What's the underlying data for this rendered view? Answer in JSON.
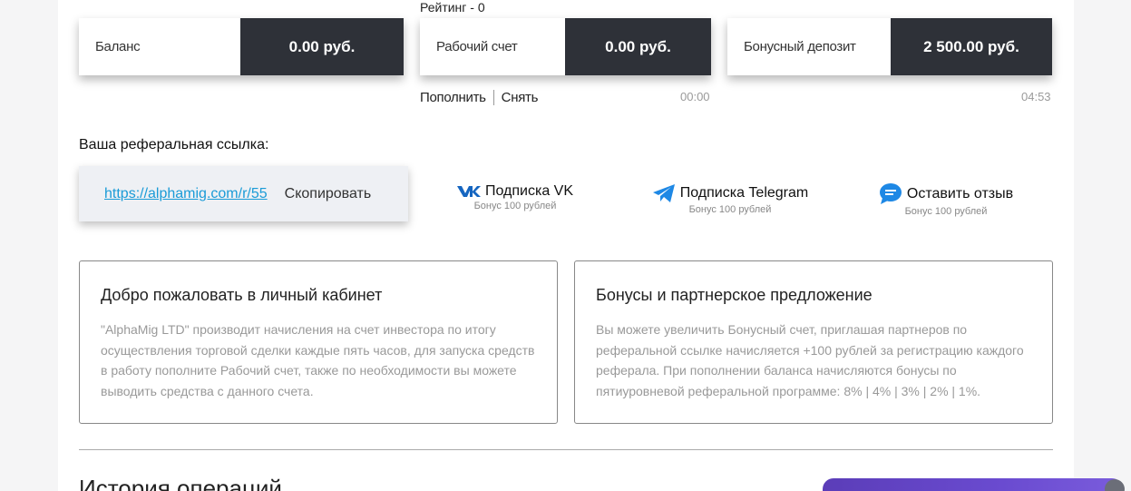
{
  "rating": "Рейтинг - 0",
  "cards": [
    {
      "label": "Баланс",
      "value": "0.00 руб."
    },
    {
      "label": "Рабочий счет",
      "value": "0.00 руб."
    },
    {
      "label": "Бонусный депозит",
      "value": "2 500.00 руб."
    }
  ],
  "actions": {
    "deposit": "Пополнить",
    "withdraw": "Снять"
  },
  "timers": {
    "working": "00:00",
    "bonus": "04:53"
  },
  "referral": {
    "title": "Ваша реферальная ссылка:",
    "link": "https://alphamig.com/r/55",
    "copy_label": "Скопировать"
  },
  "socials": [
    {
      "label": "Подписка VK",
      "sub": "Бонус 100 рублей",
      "icon": "vk-icon",
      "color": "#1565c0"
    },
    {
      "label": "Подписка Telegram",
      "sub": "Бонус 100 рублей",
      "icon": "telegram-icon",
      "color": "#1e88e5"
    },
    {
      "label": "Оставить отзыв",
      "sub": "Бонус 100 рублей",
      "icon": "chat-bubble-icon",
      "color": "#1e88e5"
    }
  ],
  "welcome": {
    "title": "Добро пожаловать в личный кабинет",
    "text": "\"AlphaMig LTD\" производит начисления на счет инвестора по итогу осуществления торговой сделки каждые пять часов, для запуска средств в работу пополните Рабочий счет, также по необходимости вы можете выводить средства с данного счета."
  },
  "bonus_info": {
    "title": "Бонусы и партнерское предложение",
    "text": "Вы можете увеличить Бонусный счет, приглашая партнеров по реферальной ссылке начисляется +100 рублей за регистрацию каждого реферала. При пополнении баланса начисляются бонусы по пятиуровневой реферальной программе: 8% | 4% | 3% | 2% | 1%."
  },
  "history_title": "История операций",
  "colors": {
    "card_dark": "#2e3138",
    "link": "#1a9bd7",
    "chat_widget": "#6a4bd0"
  }
}
